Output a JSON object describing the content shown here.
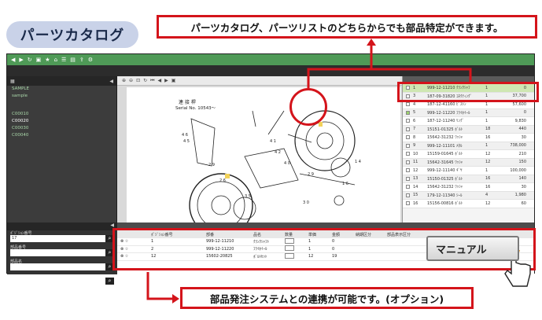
{
  "title": "パーツカタログ",
  "callouts": {
    "top": "パーツカタログ、パーツリストのどちらからでも部品特定ができます。",
    "bottom": "部品発注システムとの連携が可能です。(オプション)"
  },
  "manual_button": "マニュアル",
  "sidebar": {
    "heading": "SAMPLE",
    "group": "sample",
    "items": [
      "C00010",
      "C00020",
      "C00030",
      "C00040"
    ]
  },
  "viewer": {
    "drawing_title": "連 接 桿",
    "serial": "Serial No. 10543～"
  },
  "parts_list": {
    "rows": [
      {
        "no": "1",
        "code": "999-12-11210 ｸﾗﾝｸｼｬﾌ",
        "qty": "1",
        "price": "0",
        "selected": true
      },
      {
        "no": "3",
        "code": "187-09-31820 ｺﾈｸﾃｨﾝｸﾞ",
        "qty": "1",
        "price": "37,700"
      },
      {
        "no": "4",
        "code": "187-12-41160 ﾋﾟｽﾄﾝ",
        "qty": "1",
        "price": "57,600"
      },
      {
        "no": "5",
        "code": "999-12-11220 ﾌﾗｲﾎｲｰﾙ",
        "qty": "1",
        "price": "0",
        "highlight": true
      },
      {
        "no": "6",
        "code": "187-12-11240 ﾘﾝｸﾞ",
        "qty": "1",
        "price": "9,830"
      },
      {
        "no": "7",
        "code": "15151-01325 ﾎﾞﾙﾄ",
        "qty": "18",
        "price": "440"
      },
      {
        "no": "8",
        "code": "15642-31232 ﾜｯｼｬ",
        "qty": "16",
        "price": "30"
      },
      {
        "no": "9",
        "code": "999-12-11101 ﾒﾀﾙ",
        "qty": "1",
        "price": "738,000"
      },
      {
        "no": "10",
        "code": "15159-01645 ﾎﾞﾙﾄ",
        "qty": "12",
        "price": "210"
      },
      {
        "no": "11",
        "code": "15642-31645 ﾜｯｼｬ",
        "qty": "12",
        "price": "150"
      },
      {
        "no": "12",
        "code": "999-12-11140 ｷﾞﾔ",
        "qty": "1",
        "price": "100,000"
      },
      {
        "no": "13",
        "code": "15150-01325 ﾎﾞﾙﾄ",
        "qty": "16",
        "price": "140"
      },
      {
        "no": "14",
        "code": "15642-31232 ﾜｯｼｬ",
        "qty": "16",
        "price": "30"
      },
      {
        "no": "15",
        "code": "179-12-11340 ｼｰﾙ",
        "qty": "4",
        "price": "1,980"
      },
      {
        "no": "16",
        "code": "15156-00816 ﾎﾞﾙﾄ",
        "qty": "12",
        "price": "60"
      }
    ]
  },
  "search_fields": [
    {
      "label": "ﾎﾟｼﾞｼｮﾝ番号",
      "value": "17"
    },
    {
      "label": "部品番号",
      "value": ""
    },
    {
      "label": "部品名",
      "value": ""
    },
    {
      "label": "",
      "value": ""
    }
  ],
  "order": {
    "headers": [
      "ﾎﾟｼﾞｼｮﾝ番号",
      "部番",
      "品名",
      "数量",
      "単価",
      "金額",
      "納期区分",
      "部品表示区分"
    ],
    "rows": [
      {
        "pos": "1",
        "code": "999-12-11210",
        "name": "ｸﾗﾝｸｼｬﾌﾄ",
        "qty": "1",
        "price": "0"
      },
      {
        "pos": "2",
        "code": "999-12-11220",
        "name": "ﾌﾗｲﾎｲｰﾙ",
        "qty": "1",
        "price": "0"
      },
      {
        "pos": "12",
        "code": "15602-20825",
        "name": "ﾎﾞﾙﾄｾｯﾄ",
        "qty": "12",
        "price": "19"
      }
    ]
  },
  "colors": {
    "accent_red": "#d4141b",
    "toolbar_green": "#4f9a57",
    "pill_blue": "#c9d2e8"
  }
}
